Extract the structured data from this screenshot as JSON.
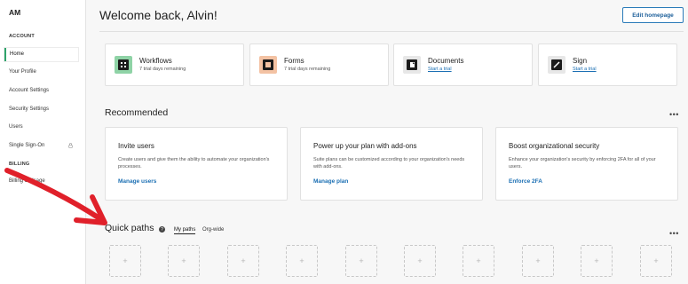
{
  "sidebar": {
    "avatar": "AM",
    "account_heading": "ACCOUNT",
    "items": [
      {
        "label": "Home"
      },
      {
        "label": "Your Profile"
      },
      {
        "label": "Account Settings"
      },
      {
        "label": "Security Settings"
      },
      {
        "label": "Users"
      },
      {
        "label": "Single Sign-On"
      }
    ],
    "billing_heading": "BILLING",
    "billing_items": [
      {
        "label": "Billing & Usage"
      }
    ]
  },
  "header": {
    "welcome": "Welcome back, Alvin!",
    "edit_button": "Edit homepage"
  },
  "products": [
    {
      "title": "Workflows",
      "sub": "7 trial days remaining",
      "icon": "workflows-icon",
      "color": "#8fd3a6"
    },
    {
      "title": "Forms",
      "sub": "7 trial days remaining",
      "icon": "forms-icon",
      "color": "#f3c2a3"
    },
    {
      "title": "Documents",
      "sub": "Start a trial",
      "icon": "documents-icon",
      "color": "#e7e7e7"
    },
    {
      "title": "Sign",
      "sub": "Start a trial",
      "icon": "sign-icon",
      "color": "#e7e7e7"
    }
  ],
  "recommended": {
    "title": "Recommended",
    "cards": [
      {
        "title": "Invite users",
        "desc": "Create users and give them the ability to automate your organization's processes.",
        "link": "Manage users"
      },
      {
        "title": "Power up your plan with add-ons",
        "desc": "Suite plans can be customized according to your organization's needs with add-ons.",
        "link": "Manage plan"
      },
      {
        "title": "Boost organizational security",
        "desc": "Enhance your organization's security by enforcing 2FA for all of your users.",
        "link": "Enforce 2FA"
      }
    ]
  },
  "quick_paths": {
    "title": "Quick paths",
    "tabs": [
      {
        "label": "My paths"
      },
      {
        "label": "Org-wide"
      }
    ],
    "slot_symbol": "+"
  },
  "colors": {
    "accent_link": "#1b6fb3",
    "active_indicator": "#2fa36b",
    "annotation_arrow": "#e0202a"
  }
}
